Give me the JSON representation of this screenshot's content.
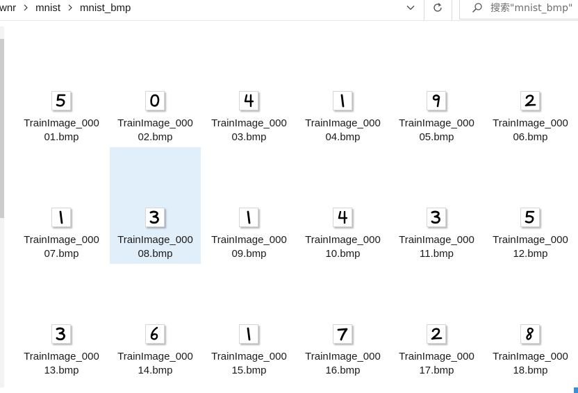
{
  "breadcrumb": [
    "wnr",
    "mnist",
    "mnist_bmp"
  ],
  "search": {
    "placeholder": "搜索\"mnist_bmp\""
  },
  "toolbar": {
    "history_icon": "chevron-down-icon",
    "refresh_icon": "refresh-icon",
    "search_icon": "search-icon"
  },
  "files": [
    {
      "line1": "TrainImage_000",
      "line2": "01.bmp",
      "digit": "5",
      "selected": false
    },
    {
      "line1": "TrainImage_000",
      "line2": "02.bmp",
      "digit": "0",
      "selected": false
    },
    {
      "line1": "TrainImage_000",
      "line2": "03.bmp",
      "digit": "4",
      "selected": false
    },
    {
      "line1": "TrainImage_000",
      "line2": "04.bmp",
      "digit": "1",
      "selected": false
    },
    {
      "line1": "TrainImage_000",
      "line2": "05.bmp",
      "digit": "9",
      "selected": false
    },
    {
      "line1": "TrainImage_000",
      "line2": "06.bmp",
      "digit": "2",
      "selected": false
    },
    {
      "line1": "TrainImage_000",
      "line2": "07.bmp",
      "digit": "1",
      "selected": false
    },
    {
      "line1": "TrainImage_000",
      "line2": "08.bmp",
      "digit": "3",
      "selected": true
    },
    {
      "line1": "TrainImage_000",
      "line2": "09.bmp",
      "digit": "1",
      "selected": false
    },
    {
      "line1": "TrainImage_000",
      "line2": "10.bmp",
      "digit": "4",
      "selected": false
    },
    {
      "line1": "TrainImage_000",
      "line2": "11.bmp",
      "digit": "3",
      "selected": false
    },
    {
      "line1": "TrainImage_000",
      "line2": "12.bmp",
      "digit": "5",
      "selected": false
    },
    {
      "line1": "TrainImage_000",
      "line2": "13.bmp",
      "digit": "3",
      "selected": false
    },
    {
      "line1": "TrainImage_000",
      "line2": "14.bmp",
      "digit": "6",
      "selected": false
    },
    {
      "line1": "TrainImage_000",
      "line2": "15.bmp",
      "digit": "1",
      "selected": false
    },
    {
      "line1": "TrainImage_000",
      "line2": "16.bmp",
      "digit": "7",
      "selected": false
    },
    {
      "line1": "TrainImage_000",
      "line2": "17.bmp",
      "digit": "2",
      "selected": false
    },
    {
      "line1": "TrainImage_000",
      "line2": "18.bmp",
      "digit": "8",
      "selected": false
    }
  ],
  "colors": {
    "selection": "#e1effb",
    "text": "#1a1a1a",
    "accent": "#3a8fd9"
  }
}
